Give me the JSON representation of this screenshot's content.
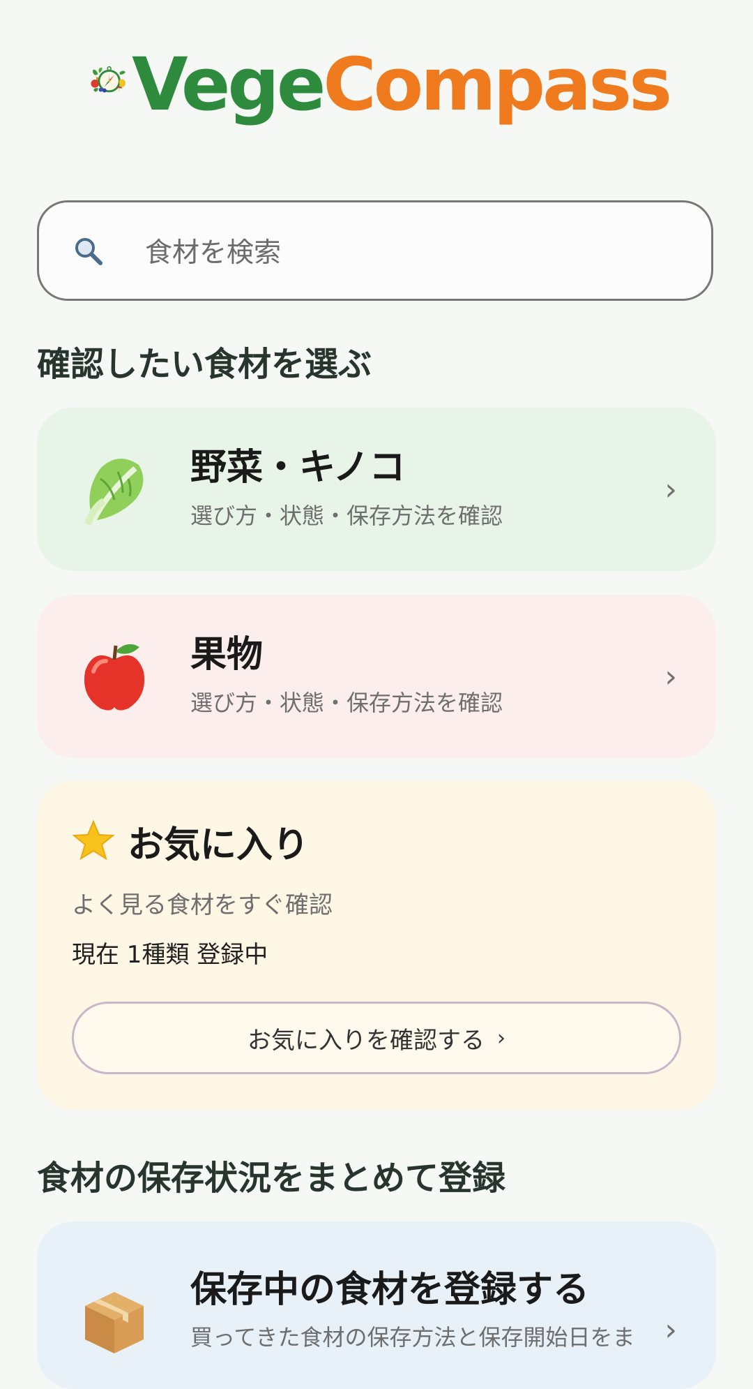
{
  "logo": {
    "wordmark_part1": "Vege",
    "wordmark_part2": "Compass"
  },
  "search": {
    "placeholder": "食材を検索",
    "icon": "search-icon"
  },
  "section1": {
    "title": "確認したい食材を選ぶ"
  },
  "categories": [
    {
      "title": "野菜・キノコ",
      "subtitle": "選び方・状態・保存方法を確認",
      "icon": "lettuce-icon",
      "bg": "#e8f4e8",
      "arrow": "›"
    },
    {
      "title": "果物",
      "subtitle": "選び方・状態・保存方法を確認",
      "icon": "apple-icon",
      "bg": "#fdeeee",
      "arrow": "›"
    }
  ],
  "favorites": {
    "title": "お気に入り",
    "icon": "star-icon",
    "subtitle": "よく見る食材をすぐ確認",
    "count_text": "現在 1種類 登録中",
    "button_label": "お気に入りを確認する",
    "button_arrow": "›",
    "bg": "#fff7e6"
  },
  "section2": {
    "title": "食材の保存状況をまとめて登録"
  },
  "storage_card": {
    "title": "保存中の食材を登録する",
    "subtitle": "買ってきた食材の保存方法と保存開始日をま",
    "icon": "package-icon",
    "bg": "#e9f1f8",
    "arrow": "›"
  },
  "colors": {
    "accent_green": "#2e8b3d",
    "accent_orange": "#f07a1e",
    "background": "#f5f8f5"
  }
}
